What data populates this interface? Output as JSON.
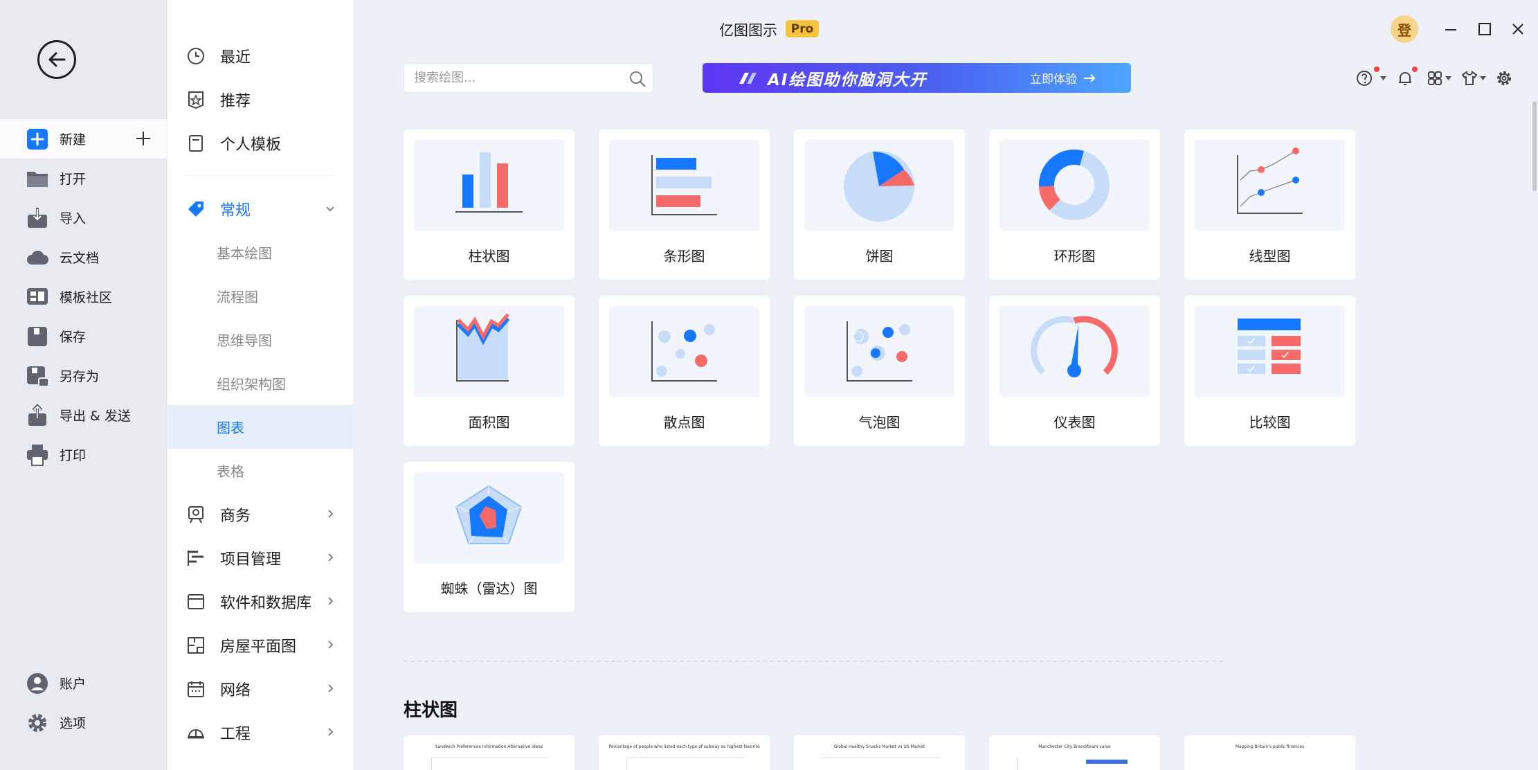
{
  "app": {
    "title": "亿图图示",
    "badge": "Pro",
    "avatar_char": "登"
  },
  "left_nav": {
    "items": [
      {
        "label": "新建",
        "icon": "new-doc-icon"
      },
      {
        "label": "打开",
        "icon": "folder-icon"
      },
      {
        "label": "导入",
        "icon": "import-icon"
      },
      {
        "label": "云文档",
        "icon": "cloud-icon"
      },
      {
        "label": "模板社区",
        "icon": "template-community-icon"
      },
      {
        "label": "保存",
        "icon": "save-icon"
      },
      {
        "label": "另存为",
        "icon": "save-as-icon"
      },
      {
        "label": "导出 & 发送",
        "icon": "export-icon"
      },
      {
        "label": "打印",
        "icon": "print-icon"
      }
    ],
    "bottom": [
      {
        "label": "账户",
        "icon": "account-icon"
      },
      {
        "label": "选项",
        "icon": "gear-icon"
      }
    ]
  },
  "categories": {
    "top": [
      {
        "label": "最近",
        "icon": "clock-icon"
      },
      {
        "label": "推荐",
        "icon": "star-badge-icon"
      },
      {
        "label": "个人模板",
        "icon": "personal-template-icon"
      }
    ],
    "general": {
      "label": "常规"
    },
    "sub": [
      "基本绘图",
      "流程图",
      "思维导图",
      "组织架构图",
      "图表",
      "表格"
    ],
    "selected_sub": "图表",
    "groups": [
      {
        "label": "商务"
      },
      {
        "label": "项目管理"
      },
      {
        "label": "软件和数据库"
      },
      {
        "label": "房屋平面图"
      },
      {
        "label": "网络"
      },
      {
        "label": "工程"
      }
    ]
  },
  "search": {
    "placeholder": "搜索绘图..."
  },
  "banner": {
    "text": "AI绘图助你脑洞大开",
    "cta": "立即体验"
  },
  "colors": {
    "accent": "#1677ff",
    "chart_blue": "#1677ff",
    "chart_light": "#c6dcf8",
    "chart_red": "#f76a6a",
    "pro": "#f5c43c"
  },
  "chart_types": [
    {
      "label": "柱状图"
    },
    {
      "label": "条形图"
    },
    {
      "label": "饼图"
    },
    {
      "label": "环形图"
    },
    {
      "label": "线型图"
    },
    {
      "label": "面积图"
    },
    {
      "label": "散点图"
    },
    {
      "label": "气泡图"
    },
    {
      "label": "仪表图"
    },
    {
      "label": "比较图"
    },
    {
      "label": "蜘蛛（雷达）图"
    }
  ],
  "section": {
    "title": "柱状图"
  },
  "templates": [
    {
      "title": "Sandwich Preferences Information Alternative Ideas"
    },
    {
      "title": "Percentage of people who listed each type of subway as highest favorite"
    },
    {
      "title": "Global Healthy Snacks Market vs US Market"
    },
    {
      "title": "Manchester City Brand/team value"
    },
    {
      "title": "Mapping Britain's public finances"
    }
  ]
}
